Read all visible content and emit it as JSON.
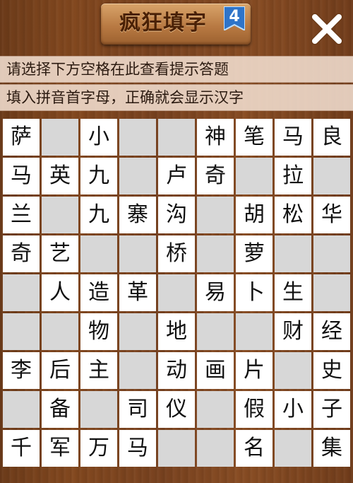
{
  "header": {
    "title": "疯狂填字",
    "level": "4",
    "close_label": "✕"
  },
  "hints": {
    "line1": "请选择下方空格在此查看提示答题",
    "line2": "填入拼音首字母，正确就会显示汉字"
  },
  "colors": {
    "badge_blue": "#2e74c9",
    "empty_cell": "#d7d7d7",
    "filled_cell": "#ffffff"
  },
  "grid": [
    [
      "萨",
      "",
      "小",
      "",
      "",
      "神",
      "笔",
      "马",
      "良"
    ],
    [
      "马",
      "英",
      "九",
      "",
      "卢",
      "奇",
      "",
      "拉",
      ""
    ],
    [
      "兰",
      "",
      "九",
      "寨",
      "沟",
      "",
      "胡",
      "松",
      "华"
    ],
    [
      "奇",
      "艺",
      "",
      "",
      "桥",
      "",
      "萝",
      "",
      ""
    ],
    [
      "",
      "人",
      "造",
      "革",
      "",
      "易",
      "卜",
      "生",
      ""
    ],
    [
      "",
      "",
      "物",
      "",
      "地",
      "",
      "",
      "财",
      "经"
    ],
    [
      "李",
      "后",
      "主",
      "",
      "动",
      "画",
      "片",
      "",
      "史"
    ],
    [
      "",
      "备",
      "",
      "司",
      "仪",
      "",
      "假",
      "小",
      "子"
    ],
    [
      "千",
      "军",
      "万",
      "马",
      "",
      "",
      "名",
      "",
      "集"
    ]
  ]
}
